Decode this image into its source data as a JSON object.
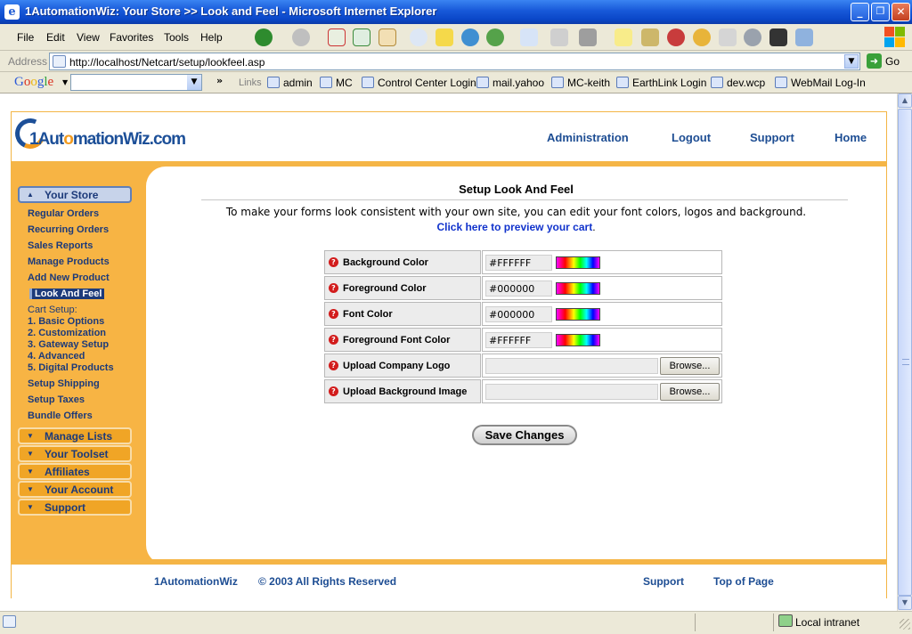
{
  "window": {
    "title": "1AutomationWiz: Your Store >> Look and Feel - Microsoft Internet Explorer",
    "app_icon": "e",
    "minimize": "_",
    "maximize": "❐",
    "close": "✕"
  },
  "menu": [
    "File",
    "Edit",
    "View",
    "Favorites",
    "Tools",
    "Help"
  ],
  "address": {
    "label": "Address",
    "url": "http://localhost/Netcart/setup/lookfeel.asp",
    "go_label": "Go"
  },
  "links_bar": {
    "google_letters": [
      "G",
      "o",
      "o",
      "g",
      "l",
      "e"
    ],
    "links_label": "Links",
    "links": [
      "admin",
      "MC",
      "Control Center Login",
      "mail.yahoo",
      "MC-keith",
      "EarthLink  Login",
      "dev.wcp",
      "WebMail Log-In"
    ]
  },
  "site": {
    "logo_prefix": "1Aut",
    "logo_o": "o",
    "logo_suffix": "mationWiz.com",
    "nav": [
      "Administration",
      "Logout",
      "Support",
      "Home"
    ]
  },
  "sidebar": {
    "your_store": "Your Store",
    "links": [
      "Regular Orders",
      "Recurring Orders",
      "Sales Reports",
      "Manage Products",
      "Add New Product"
    ],
    "current": "Look And Feel",
    "cart_setup_label": "Cart Setup:",
    "cart_setup": [
      "1. Basic Options",
      "2. Customization",
      "3. Gateway Setup",
      "4. Advanced",
      "5. Digital Products"
    ],
    "links2": [
      "Setup Shipping",
      "Setup Taxes",
      "Bundle Offers"
    ],
    "sections": [
      "Manage Lists",
      "Your Toolset",
      "Affiliates",
      "Your Account",
      "Support"
    ]
  },
  "form": {
    "title": "Setup Look And Feel",
    "description": "To make your forms look consistent with your own site, you can edit your font colors, logos and background.",
    "preview_link": "Click here to preview your cart",
    "preview_period": ".",
    "help_glyph": "?",
    "color_rows": [
      {
        "label": "Background Color",
        "value": "#FFFFFF"
      },
      {
        "label": "Foreground Color",
        "value": "#000000"
      },
      {
        "label": "Font Color",
        "value": "#000000"
      },
      {
        "label": "Foreground Font Color",
        "value": "#FFFFFF"
      }
    ],
    "upload_rows": [
      {
        "label": "Upload Company Logo",
        "button": "Browse..."
      },
      {
        "label": "Upload Background Image",
        "button": "Browse..."
      }
    ],
    "save_label": "Save Changes"
  },
  "footer": {
    "brand": "1AutomationWiz",
    "copyright": "© 2003 All Rights Reserved",
    "support": "Support",
    "top": "Top of Page"
  },
  "status": {
    "zone": "Local intranet"
  },
  "colors": {
    "brand_orange": "#f7b444",
    "brand_blue": "#1c3a7a",
    "link_blue": "#1133cc"
  }
}
